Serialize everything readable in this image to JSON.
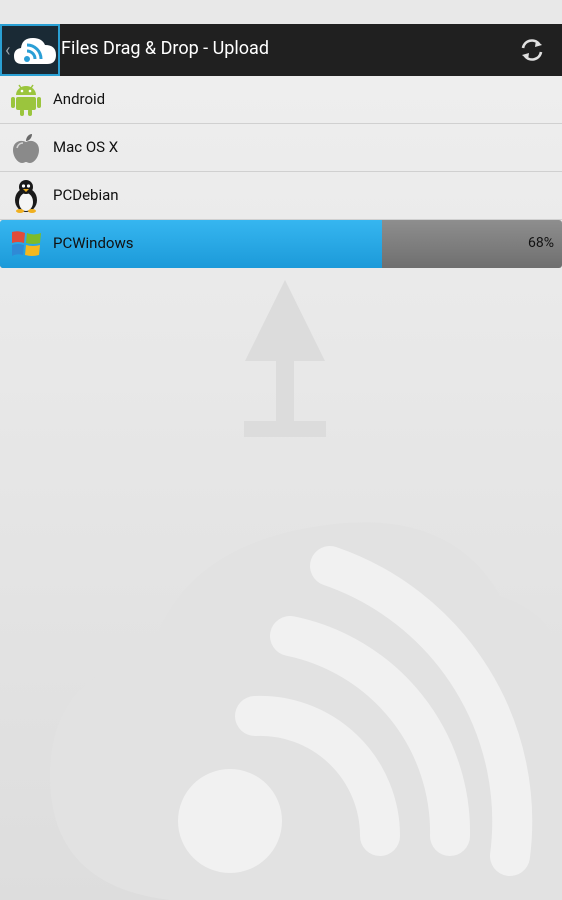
{
  "app": {
    "title": "Files Drag & Drop - Upload"
  },
  "devices": [
    {
      "name": "Android",
      "icon": "android-icon"
    },
    {
      "name": "Mac OS X",
      "icon": "apple-icon"
    },
    {
      "name": "PCDebian",
      "icon": "linux-penguin-icon"
    },
    {
      "name": "PCWindows",
      "icon": "windows-icon",
      "progress": 0.68,
      "progress_label": "68%"
    }
  ],
  "colors": {
    "accent": "#1c9ad9",
    "actionbar": "#202020",
    "progress_track": "#7a7a7a"
  }
}
